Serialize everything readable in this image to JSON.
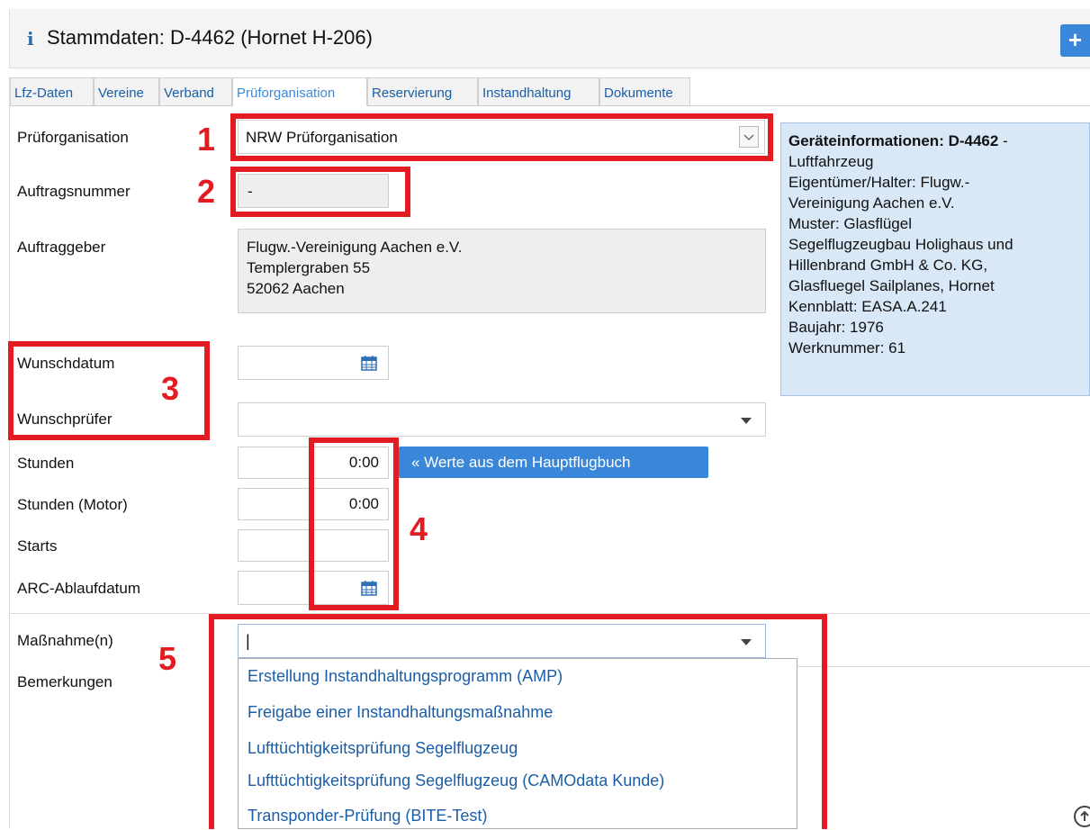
{
  "header": {
    "info_icon": "info-icon",
    "title": "Stammdaten: D-4462 (Hornet H-206)",
    "plus_label": "+"
  },
  "tabs": [
    {
      "label": "Lfz-Daten"
    },
    {
      "label": "Vereine"
    },
    {
      "label": "Verband"
    },
    {
      "label": "Prüforganisation",
      "active": true
    },
    {
      "label": "Reservierung"
    },
    {
      "label": "Instandhaltung"
    },
    {
      "label": "Dokumente"
    }
  ],
  "form": {
    "pruef_label": "Prüforganisation",
    "pruef_value": "NRW Prüforganisation",
    "auftrag_label": "Auftragsnummer",
    "auftrag_value": "-",
    "auftraggeber_label": "Auftraggeber",
    "auftraggeber_lines": [
      "Flugw.-Vereinigung Aachen e.V.",
      "Templergraben 55",
      "52062 Aachen"
    ],
    "wunschdatum_label": "Wunschdatum",
    "wunschdatum_value": "",
    "wunschpruefer_label": "Wunschprüfer",
    "wunschpruefer_value": "",
    "stunden_label": "Stunden",
    "stunden_value": "0:00",
    "stunden_motor_label": "Stunden (Motor)",
    "stunden_motor_value": "0:00",
    "starts_label": "Starts",
    "starts_value": "",
    "arc_label": "ARC-Ablaufdatum",
    "arc_value": "",
    "massnahme_label": "Maßnahme(n)",
    "massnahme_value": "|",
    "bemerkungen_label": "Bemerkungen"
  },
  "hauptflugbuch_button": "« Werte aus dem Hauptflugbuch",
  "info_panel": {
    "heading": "Geräteinformationen: D-4462",
    "heading_suffix": " -",
    "lines": [
      "Luftfahrzeug",
      "Eigentümer/Halter: Flugw.-",
      "Vereinigung Aachen e.V.",
      "Muster: Glasflügel",
      "Segelflugzeugbau Holighaus und",
      "Hillenbrand GmbH & Co. KG,",
      "Glasfluegel Sailplanes, Hornet",
      "Kennblatt: EASA.A.241",
      "Baujahr: 1976",
      "Werknummer: 61"
    ]
  },
  "dropdown_options": [
    "Erstellung Instandhaltungsprogramm (AMP)",
    "Freigabe einer Instandhaltungsmaßnahme",
    "Lufttüchtigkeitsprüfung Segelflugzeug",
    "Lufttüchtigkeitsprüfung Segelflugzeug (CAMOdata Kunde)",
    "Transponder-Prüfung (BITE-Test)"
  ],
  "annotations": [
    "1",
    "2",
    "3",
    "4",
    "5"
  ],
  "colors": {
    "accent": "#3a87d9",
    "annotation_red": "#e21c22",
    "info_panel_bg": "#d9e8f7",
    "link_blue": "#1a5ea8"
  }
}
